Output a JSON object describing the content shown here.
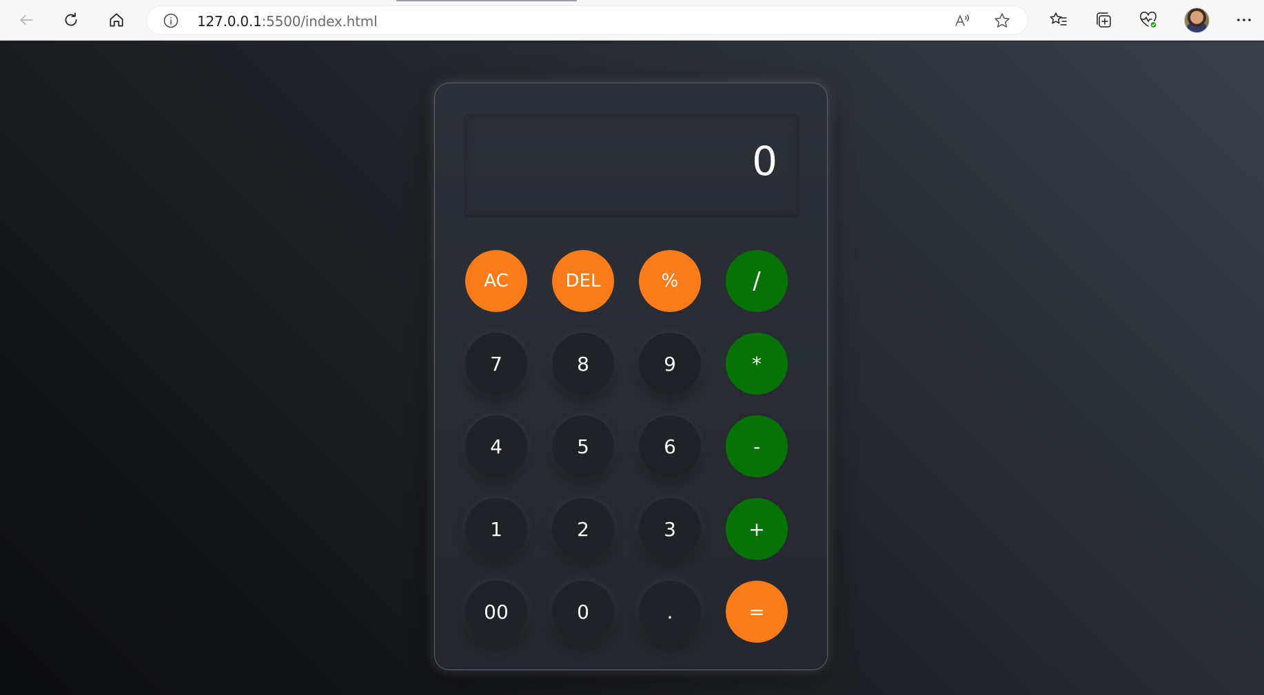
{
  "browser": {
    "url_host": "127.0.0.1",
    "url_rest": ":5500/index.html",
    "icons": {
      "back": "back-arrow-icon",
      "reload": "reload-icon",
      "home": "home-icon",
      "site_info": "info-icon",
      "read_aloud": "read-aloud-icon",
      "favorite": "star-icon",
      "favorites": "favorites-list-icon",
      "collections": "collections-icon",
      "health": "browser-essentials-icon",
      "more": "more-icon"
    }
  },
  "calculator": {
    "display": "0",
    "keys": [
      [
        "AC",
        "DEL",
        "%",
        "/"
      ],
      [
        "7",
        "8",
        "9",
        "*"
      ],
      [
        "4",
        "5",
        "6",
        "-"
      ],
      [
        "1",
        "2",
        "3",
        "+"
      ],
      [
        "00",
        "0",
        ".",
        "="
      ]
    ],
    "colors": {
      "accent_orange": "#fb7c1a",
      "accent_green": "#067306",
      "digit_key": "#1f2227",
      "panel": "#2a2e35"
    }
  }
}
